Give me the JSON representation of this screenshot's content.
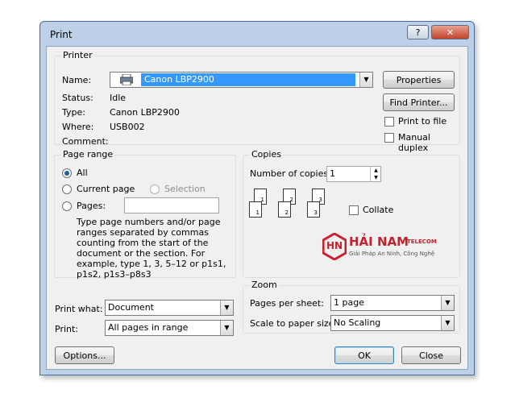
{
  "window": {
    "title": "Print",
    "help_label": "?",
    "close_label": "✕"
  },
  "printer": {
    "group_title": "Printer",
    "name_label": "Name:",
    "name_value": "Canon LBP2900",
    "status_label": "Status:",
    "status_value": "Idle",
    "type_label": "Type:",
    "type_value": "Canon LBP2900",
    "where_label": "Where:",
    "where_value": "USB002",
    "comment_label": "Comment:",
    "properties_label": "Properties",
    "find_printer_label": "Find Printer...",
    "print_to_file_label": "Print to file",
    "manual_duplex_label": "Manual duplex"
  },
  "page_range": {
    "group_title": "Page range",
    "all_label": "All",
    "current_page_label": "Current page",
    "selection_label": "Selection",
    "pages_label": "Pages:",
    "pages_value": "",
    "help_text": "Type page numbers and/or page ranges separated by commas counting from the start of the document or the section. For example, type 1, 3, 5–12 or p1s1, p1s2, p1s3–p8s3"
  },
  "copies": {
    "group_title": "Copies",
    "number_label": "Number of copies:",
    "number_value": "1",
    "collate_label": "Collate",
    "page_numbers": [
      "1",
      "1",
      "2",
      "2",
      "3",
      "3"
    ]
  },
  "watermark": {
    "brand": "HẢI NAM",
    "sub": "TELECOM",
    "tagline": "Giải Pháp An Ninh, Công Nghệ",
    "monogram": "HN",
    "color": "#c8202c"
  },
  "print_what": {
    "label": "Print what:",
    "value": "Document"
  },
  "print": {
    "label": "Print:",
    "value": "All pages in range"
  },
  "zoom": {
    "group_title": "Zoom",
    "pages_per_sheet_label": "Pages per sheet:",
    "pages_per_sheet_value": "1 page",
    "scale_label": "Scale to paper size:",
    "scale_value": "No Scaling"
  },
  "footer": {
    "options_label": "Options...",
    "ok_label": "OK",
    "close_label": "Close"
  }
}
